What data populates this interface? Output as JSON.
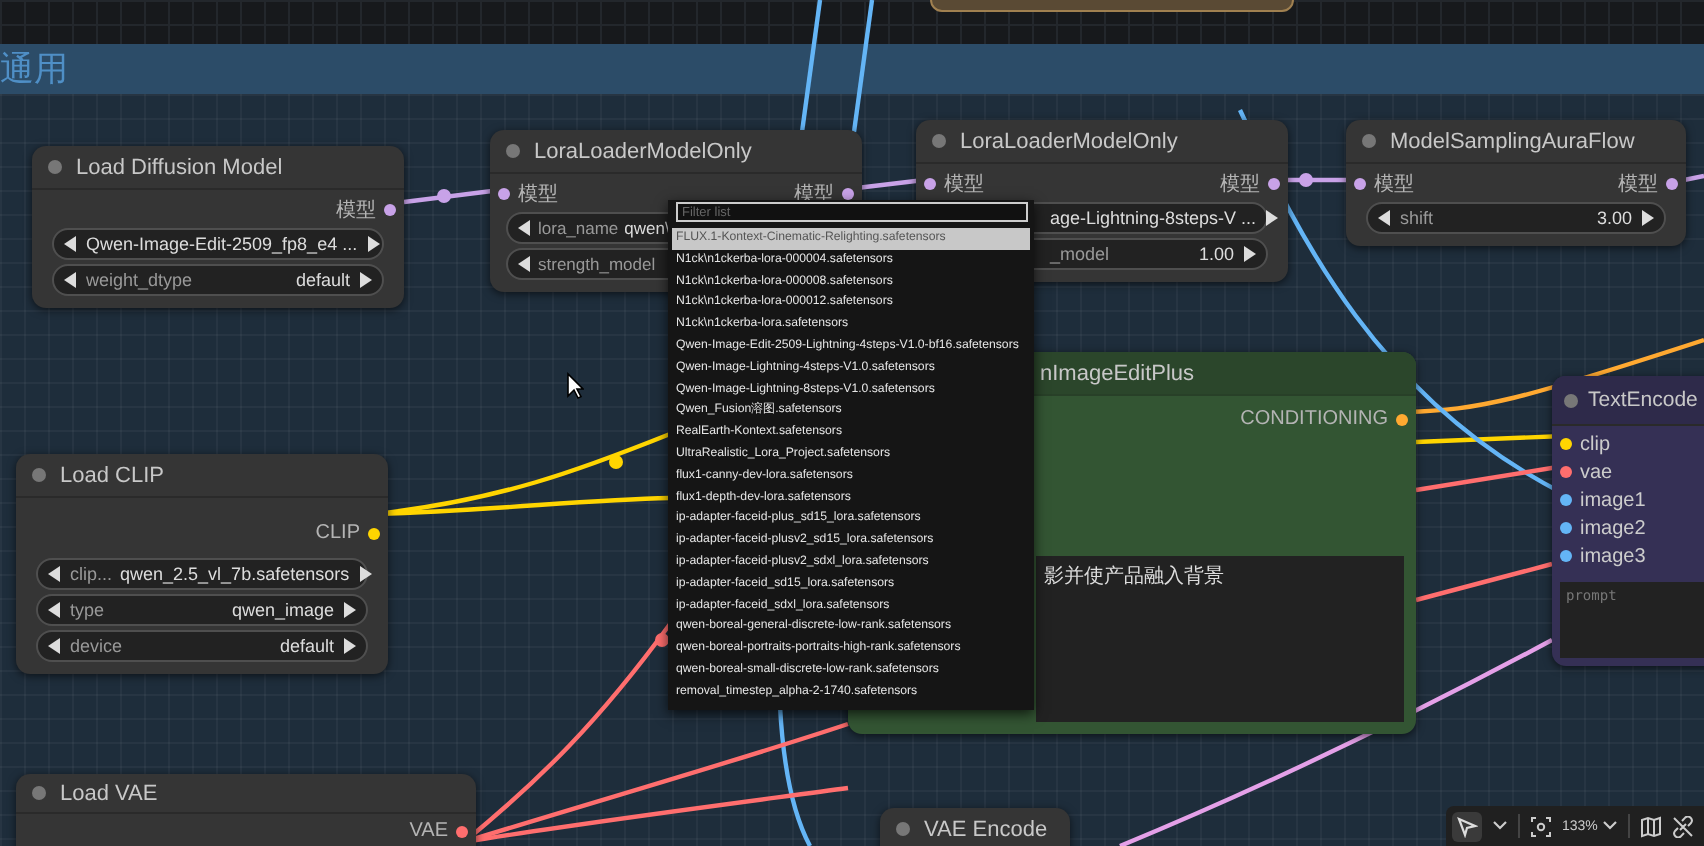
{
  "group": {
    "title": "通用"
  },
  "nodes": [
    {
      "title": "Load Diffusion Model",
      "kind": "plain",
      "outputs": [
        {
          "label": "模型",
          "color": "#c8a2e8"
        }
      ],
      "widgets": [
        {
          "value": "Qwen-Image-Edit-2509_fp8_e4 ..."
        },
        {
          "label": "weight_dtype",
          "value": "default"
        }
      ]
    },
    {
      "title": "LoraLoaderModelOnly",
      "kind": "plain",
      "inputs": [
        {
          "label": "模型",
          "color": "#c8a2e8"
        }
      ],
      "outputs": [
        {
          "label": "模型",
          "color": "#c8a2e8"
        }
      ],
      "widgets": [
        {
          "label": "lora_name",
          "value": "qwen\\"
        },
        {
          "label": "strength_model"
        }
      ]
    },
    {
      "title": "LoraLoaderModelOnly",
      "kind": "plain",
      "inputs": [
        {
          "label": "模型",
          "color": "#c8a2e8"
        }
      ],
      "outputs": [
        {
          "label": "模型",
          "color": "#c8a2e8"
        }
      ],
      "widgets": [
        {
          "value": "age-Lightning-8steps-V ..."
        },
        {
          "label": "_model",
          "value": "1.00"
        }
      ]
    },
    {
      "title": "ModelSamplingAuraFlow",
      "kind": "plain",
      "inputs": [
        {
          "label": "模型",
          "color": "#c8a2e8"
        }
      ],
      "outputs": [
        {
          "label": "模型",
          "color": "#c8a2e8"
        }
      ],
      "widgets": [
        {
          "label": "shift",
          "value": "3.00"
        }
      ]
    },
    {
      "title": "Load CLIP",
      "kind": "plain",
      "outputs": [
        {
          "label": "CLIP",
          "color": "#ffd500"
        }
      ],
      "widgets": [
        {
          "label": "clip...",
          "value": "qwen_2.5_vl_7b.safetensors"
        },
        {
          "label": "type",
          "value": "qwen_image"
        },
        {
          "label": "device",
          "value": "default"
        }
      ]
    },
    {
      "title": "Load VAE",
      "kind": "plain",
      "outputs": [
        {
          "label": "VAE",
          "color": "#ff6e6e"
        }
      ]
    },
    {
      "title": "nImageEditPlus",
      "kind": "green",
      "outputs": [
        {
          "label": "CONDITIONING",
          "color": "#ffa931"
        }
      ],
      "text": "影并使产品融入背景"
    },
    {
      "title": "TextEncode",
      "kind": "purple",
      "inputs": [
        {
          "label": "clip",
          "color": "#ffd500"
        },
        {
          "label": "vae",
          "color": "#ff6e6e"
        },
        {
          "label": "image1",
          "color": "#64b5f6"
        },
        {
          "label": "image2",
          "color": "#64b5f6"
        },
        {
          "label": "image3",
          "color": "#64b5f6"
        }
      ],
      "placeholder": "prompt"
    },
    {
      "title": "VAE Encode",
      "kind": "plain"
    }
  ],
  "lora_menu": {
    "placeholder": "Filter list",
    "items": [
      {
        "label": "FLUX.1-Kontext-Cinematic-Relighting.safetensors",
        "selected": true
      },
      {
        "label": "N1ck\\n1ckerba-lora-000004.safetensors",
        "selected": false
      },
      {
        "label": "N1ck\\n1ckerba-lora-000008.safetensors",
        "selected": false
      },
      {
        "label": "N1ck\\n1ckerba-lora-000012.safetensors",
        "selected": false
      },
      {
        "label": "N1ck\\n1ckerba-lora.safetensors",
        "selected": false
      },
      {
        "label": "Qwen-Image-Edit-2509-Lightning-4steps-V1.0-bf16.safetensors",
        "selected": false
      },
      {
        "label": "Qwen-Image-Lightning-4steps-V1.0.safetensors",
        "selected": false
      },
      {
        "label": "Qwen-Image-Lightning-8steps-V1.0.safetensors",
        "selected": false
      },
      {
        "label": "Qwen_Fusion溶图.safetensors",
        "selected": false
      },
      {
        "label": "RealEarth-Kontext.safetensors",
        "selected": false
      },
      {
        "label": "UltraRealistic_Lora_Project.safetensors",
        "selected": false
      },
      {
        "label": "flux1-canny-dev-lora.safetensors",
        "selected": false
      },
      {
        "label": "flux1-depth-dev-lora.safetensors",
        "selected": false
      },
      {
        "label": "ip-adapter-faceid-plus_sd15_lora.safetensors",
        "selected": false
      },
      {
        "label": "ip-adapter-faceid-plusv2_sd15_lora.safetensors",
        "selected": false
      },
      {
        "label": "ip-adapter-faceid-plusv2_sdxl_lora.safetensors",
        "selected": false
      },
      {
        "label": "ip-adapter-faceid_sd15_lora.safetensors",
        "selected": false
      },
      {
        "label": "ip-adapter-faceid_sdxl_lora.safetensors",
        "selected": false
      },
      {
        "label": "qwen-boreal-general-discrete-low-rank.safetensors",
        "selected": false
      },
      {
        "label": "qwen-boreal-portraits-portraits-high-rank.safetensors",
        "selected": false
      },
      {
        "label": "qwen-boreal-small-discrete-low-rank.safetensors",
        "selected": false
      },
      {
        "label": "removal_timestep_alpha-2-1740.safetensors",
        "selected": false
      }
    ]
  },
  "toolbar": {
    "zoom": "133%"
  }
}
